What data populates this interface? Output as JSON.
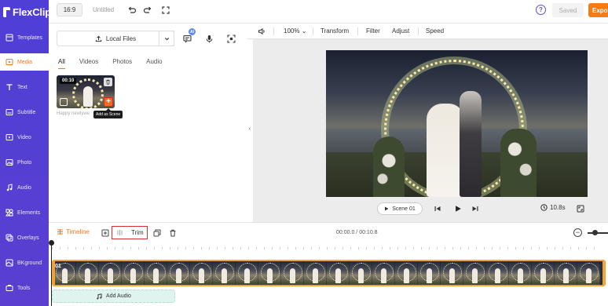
{
  "app": {
    "name": "FlexClip"
  },
  "sidebar": {
    "items": [
      {
        "label": "Templates",
        "icon": "templates-icon"
      },
      {
        "label": "Media",
        "icon": "media-icon",
        "active": true
      },
      {
        "label": "Text",
        "icon": "text-icon"
      },
      {
        "label": "Subtitle",
        "icon": "subtitle-icon"
      },
      {
        "label": "Video",
        "icon": "video-icon"
      },
      {
        "label": "Photo",
        "icon": "photo-icon"
      },
      {
        "label": "Audio",
        "icon": "audio-icon"
      },
      {
        "label": "Elements",
        "icon": "elements-icon"
      },
      {
        "label": "Overlays",
        "icon": "overlays-icon"
      },
      {
        "label": "BKground",
        "icon": "background-icon"
      },
      {
        "label": "Tools",
        "icon": "tools-icon"
      }
    ]
  },
  "topbar": {
    "ratio": "16:9",
    "title": "Untitled",
    "help": "?",
    "saved": "Saved",
    "export": "Expo"
  },
  "media": {
    "local_files": "Local Files",
    "ai_badge": "AI",
    "tabs": [
      "All",
      "Videos",
      "Photos",
      "Audio"
    ],
    "active_tab": "All",
    "item": {
      "duration": "00:10",
      "caption": "Happy newlywe",
      "tooltip": "Add as Scene"
    }
  },
  "preview": {
    "zoom": "100%",
    "tools": [
      "Transform",
      "Filter",
      "Adjust",
      "Speed"
    ],
    "scene": "Scene 01",
    "duration": "10.8s"
  },
  "timeline": {
    "label": "Timeline",
    "trim": "Trim",
    "time": "00:00.0 / 00:10.8",
    "clip_number": "01",
    "add_audio": "Add Audio"
  },
  "colors": {
    "sidebar": "#5240d4",
    "accent": "#f07a20",
    "trim_highlight": "#d93030",
    "clip_border": "#f3a236"
  }
}
